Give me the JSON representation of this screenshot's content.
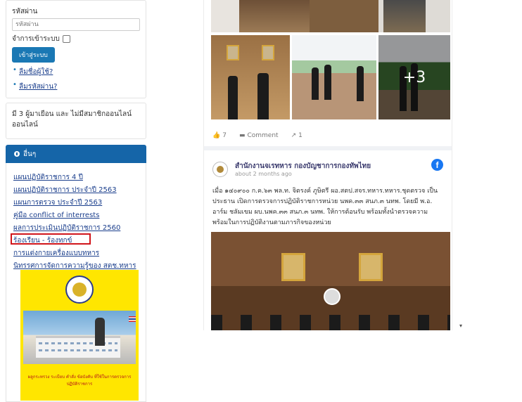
{
  "login": {
    "password_label": "รหัสผ่าน",
    "password_placeholder": "รหัสผ่าน",
    "remember_label": "จำการเข้าระบบ",
    "login_button": "เข้าสู่ระบบ",
    "links": [
      "ลืมชื่อผู้ใช้?",
      "ลืมรหัสผ่าน?"
    ]
  },
  "online": {
    "text": "มี 3 ผู้มาเยือน และ ไม่มีสมาชิกออนไลน์ ออนไลน์"
  },
  "other": {
    "heading": "อื่นๆ",
    "links": [
      "แผนปฏิบัติราชการ 4 ปี",
      "แผนปฏิบัติราชการ ประจำปี 2563",
      "แผนการตรวจ ประจำปี 2563",
      "คู่มือ conflict of interrests",
      "ผลการประเมินปฏิบัติราชการ 2560",
      "ร้องเรียน - ร้องทุกข์",
      "การแต่งกายเครื่องแบบทหาร",
      "นิทรรศการจัดการความรู้ของ สตช.ทหาร"
    ],
    "poster_caption": "ผลูกระทรวง ระเบียบ คำสั่ง ข้อบังคับ ที่ใช้ในการตรวจการปฏิบัติราชการ"
  },
  "feed": {
    "more_photos": "+3",
    "likes": "7",
    "comment_label": "Comment",
    "shares": "1",
    "page_name": "สำนักงานจเรทหาร กองบัญชาการกองทัพไทย",
    "time": "about 2 months ago",
    "post_text": "เมื่อ ๑๔๐๙๐๐ ก.ค.๖๓ พล.ท. จิตรงค์ ภูษิตรี ผอ.สตป.สจร.ทหาร.ทหาร.ชุดตรวจ เป็นประธาน เปิดการตรวจการปฏิบัติราชการหน่วย นพค.๓๓ สนภ.๓ นทพ. โดยมี พ.อ. อาร์ม ชลัมเขม ผบ.นพค.๓๓ สนภ.๓ นทพ. ให้การต้อนรับ พร้อมทั้งนำตรวจความพร้อมในการปฏิบัติงานตามภารกิจของหน่วย"
  },
  "colors": {
    "primary_blue": "#1565a8",
    "highlight_red": "#d1151b",
    "facebook_blue": "#1877f2"
  }
}
